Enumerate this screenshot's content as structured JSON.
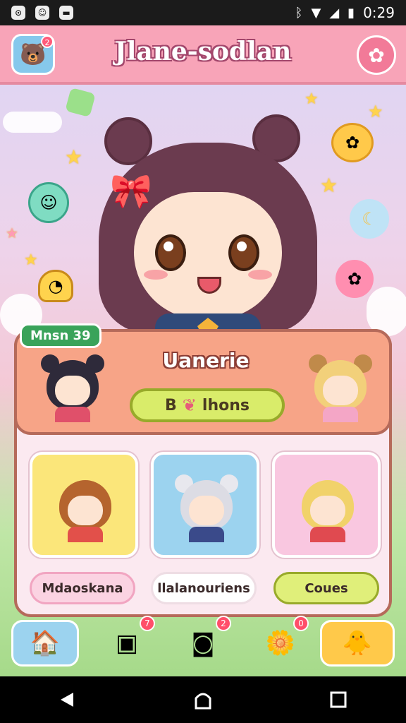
{
  "status_bar": {
    "time": "0:29",
    "icons": [
      "notification-icon",
      "game-icon",
      "media-icon",
      "bluetooth-icon",
      "wifi-icon",
      "signal-icon",
      "battery-icon"
    ]
  },
  "header": {
    "title": "Jlane-sodlan",
    "badge": "2"
  },
  "level_badge": "Mnsn 39",
  "card": {
    "name": "Uanerie",
    "button_label_a": "B",
    "button_label_b": "lhons"
  },
  "tiles": [
    {
      "label": "Mdaoskana",
      "color": "#fbe67a"
    },
    {
      "label": "llalanouriens",
      "color": "#9cd3ef"
    },
    {
      "label": "Coues",
      "color": "#f9c7e0"
    }
  ],
  "bottom_nav": {
    "badges": [
      "7",
      "2",
      "0"
    ],
    "items": [
      "home-icon",
      "cards-icon",
      "photo-icon",
      "star-face-icon",
      "chick-icon"
    ]
  },
  "colors": {
    "header_bg": "#f8a4b8",
    "card_top": "#f7a487",
    "accent_green": "#d9ec6a",
    "active_nav": "#ffc94a"
  }
}
